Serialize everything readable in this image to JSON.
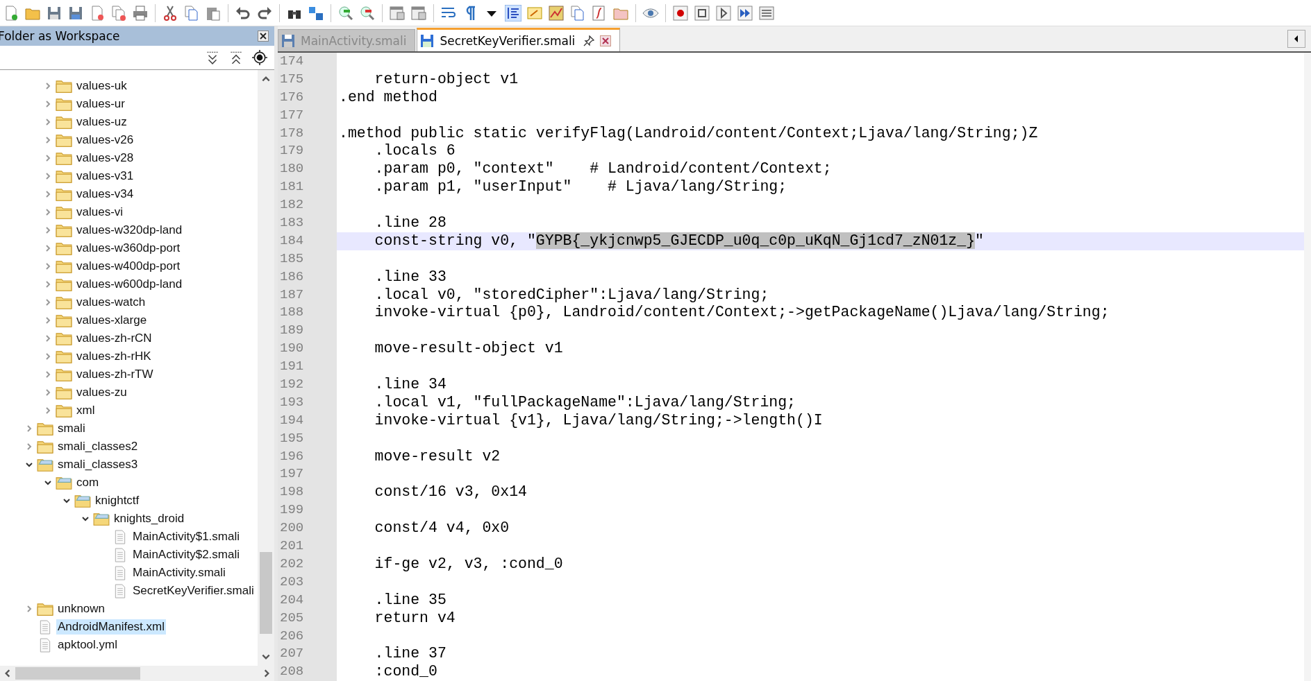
{
  "panel": {
    "title": "Folder as Workspace",
    "tree": [
      {
        "children": [
          {
            "label": "values-uk",
            "kind": "folder",
            "expanded": false,
            "selected": false
          },
          {
            "label": "values-ur",
            "kind": "folder",
            "expanded": false,
            "selected": false
          },
          {
            "label": "values-uz",
            "kind": "folder",
            "expanded": false,
            "selected": false
          },
          {
            "label": "values-v26",
            "kind": "folder",
            "expanded": false,
            "selected": false
          },
          {
            "label": "values-v28",
            "kind": "folder",
            "expanded": false,
            "selected": false
          },
          {
            "label": "values-v31",
            "kind": "folder",
            "expanded": false,
            "selected": false
          },
          {
            "label": "values-v34",
            "kind": "folder",
            "expanded": false,
            "selected": false
          },
          {
            "label": "values-vi",
            "kind": "folder",
            "expanded": false,
            "selected": false
          },
          {
            "label": "values-w320dp-land",
            "kind": "folder",
            "expanded": false,
            "selected": false
          },
          {
            "label": "values-w360dp-port",
            "kind": "folder",
            "expanded": false,
            "selected": false
          },
          {
            "label": "values-w400dp-port",
            "kind": "folder",
            "expanded": false,
            "selected": false
          },
          {
            "label": "values-w600dp-land",
            "kind": "folder",
            "expanded": false,
            "selected": false
          },
          {
            "label": "values-watch",
            "kind": "folder",
            "expanded": false,
            "selected": false
          },
          {
            "label": "values-xlarge",
            "kind": "folder",
            "expanded": false,
            "selected": false
          },
          {
            "label": "values-zh-rCN",
            "kind": "folder",
            "expanded": false,
            "selected": false
          },
          {
            "label": "values-zh-rHK",
            "kind": "folder",
            "expanded": false,
            "selected": false
          },
          {
            "label": "values-zh-rTW",
            "kind": "folder",
            "expanded": false,
            "selected": false
          },
          {
            "label": "values-zu",
            "kind": "folder",
            "expanded": false,
            "selected": false
          },
          {
            "label": "xml",
            "kind": "folder",
            "expanded": false,
            "selected": false
          }
        ]
      },
      {
        "label": "smali",
        "kind": "folder",
        "expanded": false,
        "selected": false
      },
      {
        "label": "smali_classes2",
        "kind": "folder",
        "expanded": false,
        "selected": false
      },
      {
        "label": "smali_classes3",
        "kind": "folder",
        "expanded": true,
        "selected": false,
        "children": [
          {
            "label": "com",
            "kind": "folder",
            "expanded": true,
            "selected": false,
            "children": [
              {
                "label": "knightctf",
                "kind": "folder",
                "expanded": true,
                "selected": false,
                "children": [
                  {
                    "label": "knights_droid",
                    "kind": "folder",
                    "expanded": true,
                    "selected": false,
                    "children": [
                      {
                        "label": "MainActivity$1.smali",
                        "kind": "file",
                        "selected": false
                      },
                      {
                        "label": "MainActivity$2.smali",
                        "kind": "file",
                        "selected": false
                      },
                      {
                        "label": "MainActivity.smali",
                        "kind": "file",
                        "selected": false
                      },
                      {
                        "label": "SecretKeyVerifier.smali",
                        "kind": "file",
                        "selected": false
                      }
                    ]
                  }
                ]
              }
            ]
          }
        ]
      },
      {
        "label": "unknown",
        "kind": "folder",
        "expanded": false,
        "selected": false
      },
      {
        "label": "AndroidManifest.xml",
        "kind": "file",
        "selected": true
      },
      {
        "label": "apktool.yml",
        "kind": "file",
        "selected": false
      }
    ]
  },
  "tabs": [
    {
      "label": "MainActivity.smali",
      "selected": false
    },
    {
      "label": "SecretKeyVerifier.smali",
      "selected": true
    }
  ],
  "editor": {
    "lines": [
      {
        "number": "174",
        "current": false
      },
      {
        "number": "175",
        "text": "    return-object v1",
        "current": false
      },
      {
        "number": "176",
        "text": ".end method",
        "current": false
      },
      {
        "number": "177",
        "current": false
      },
      {
        "number": "178",
        "text": ".method public static verifyFlag(Landroid/content/Context;Ljava/lang/String;)Z",
        "current": false
      },
      {
        "number": "179",
        "text": "    .locals 6",
        "current": false
      },
      {
        "number": "180",
        "text": "    .param p0, \"context\"    # Landroid/content/Context;",
        "current": false
      },
      {
        "number": "181",
        "text": "    .param p1, \"userInput\"    # Ljava/lang/String;",
        "current": false
      },
      {
        "number": "182",
        "current": false
      },
      {
        "number": "183",
        "text": "    .line 28",
        "current": false
      },
      {
        "number": "184",
        "text": "    const-string v0, \"",
        "selection": "GYPB{_ykjcnwp5_GJECDP_u0q_c0p_uKqN_Gj1cd7_zN01z_}",
        "text_after": "\"",
        "current": true
      },
      {
        "number": "185",
        "current": false
      },
      {
        "number": "186",
        "text": "    .line 33",
        "current": false
      },
      {
        "number": "187",
        "text": "    .local v0, \"storedCipher\":Ljava/lang/String;",
        "current": false
      },
      {
        "number": "188",
        "text": "    invoke-virtual {p0}, Landroid/content/Context;->getPackageName()Ljava/lang/String;",
        "current": false
      },
      {
        "number": "189",
        "current": false
      },
      {
        "number": "190",
        "text": "    move-result-object v1",
        "current": false
      },
      {
        "number": "191",
        "current": false
      },
      {
        "number": "192",
        "text": "    .line 34",
        "current": false
      },
      {
        "number": "193",
        "text": "    .local v1, \"fullPackageName\":Ljava/lang/String;",
        "current": false
      },
      {
        "number": "194",
        "text": "    invoke-virtual {v1}, Ljava/lang/String;->length()I",
        "current": false
      },
      {
        "number": "195",
        "current": false
      },
      {
        "number": "196",
        "text": "    move-result v2",
        "current": false
      },
      {
        "number": "197",
        "current": false
      },
      {
        "number": "198",
        "text": "    const/16 v3, 0x14",
        "current": false
      },
      {
        "number": "199",
        "current": false
      },
      {
        "number": "200",
        "text": "    const/4 v4, 0x0",
        "current": false
      },
      {
        "number": "201",
        "current": false
      },
      {
        "number": "202",
        "text": "    if-ge v2, v3, :cond_0",
        "current": false
      },
      {
        "number": "203",
        "current": false
      },
      {
        "number": "204",
        "text": "    .line 35",
        "current": false
      },
      {
        "number": "205",
        "text": "    return v4",
        "current": false
      },
      {
        "number": "206",
        "current": false
      },
      {
        "number": "207",
        "text": "    .line 37",
        "current": false
      },
      {
        "number": "208",
        "text": "    :cond_0",
        "current": false
      }
    ]
  }
}
